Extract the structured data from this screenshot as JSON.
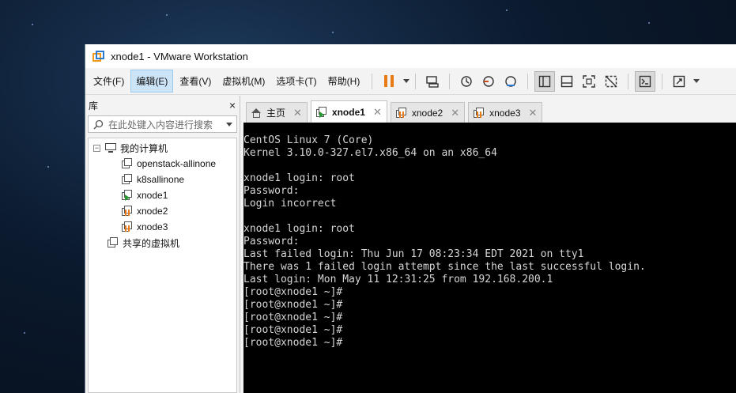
{
  "window": {
    "title": "xnode1 - VMware Workstation"
  },
  "menu": [
    {
      "label": "文件(F)",
      "name": "menu-file"
    },
    {
      "label": "编辑(E)",
      "name": "menu-edit"
    },
    {
      "label": "查看(V)",
      "name": "menu-view"
    },
    {
      "label": "虚拟机(M)",
      "name": "menu-vm"
    },
    {
      "label": "选项卡(T)",
      "name": "menu-tabs"
    },
    {
      "label": "帮助(H)",
      "name": "menu-help"
    }
  ],
  "library": {
    "title": "库",
    "close": "×",
    "search_placeholder": "在此处键入内容进行搜索",
    "tree": {
      "root_label": "我的计算机",
      "vms": [
        "openstack-allinone",
        "k8sallinone",
        "xnode1",
        "xnode2",
        "xnode3"
      ],
      "shared_label": "共享的虚拟机"
    }
  },
  "tabs": [
    {
      "label": "主页",
      "icon": "home-icon"
    },
    {
      "label": "xnode1",
      "icon": "vm-running-icon"
    },
    {
      "label": "xnode2",
      "icon": "vm-paused-icon"
    },
    {
      "label": "xnode3",
      "icon": "vm-paused-icon"
    }
  ],
  "console": {
    "lines": [
      "CentOS Linux 7 (Core)",
      "Kernel 3.10.0-327.el7.x86_64 on an x86_64",
      "",
      "xnode1 login: root",
      "Password:",
      "Login incorrect",
      "",
      "xnode1 login: root",
      "Password:",
      "Last failed login: Thu Jun 17 08:23:34 EDT 2021 on tty1",
      "There was 1 failed login attempt since the last successful login.",
      "Last login: Mon May 11 12:31:25 from 192.168.200.1",
      "[root@xnode1 ~]#",
      "[root@xnode1 ~]#",
      "[root@xnode1 ~]#",
      "[root@xnode1 ~]#",
      "[root@xnode1 ~]#"
    ]
  },
  "colors": {
    "pause_accent": "#e87b16",
    "running_green": "#2b9a36",
    "console_bg": "#000000",
    "console_fg": "#d6d6d6"
  }
}
